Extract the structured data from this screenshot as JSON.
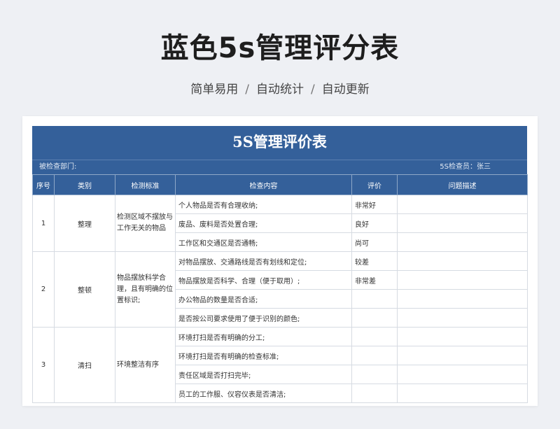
{
  "page": {
    "title": "蓝色5s管理评分表",
    "features": [
      "简单易用",
      "自动统计",
      "自动更新"
    ],
    "separator": "/"
  },
  "sheet": {
    "title": "5S管理评价表",
    "dept_label": "被检查部门:",
    "inspector_label": "5S检查员：张三",
    "columns": [
      "序号",
      "类别",
      "检测标准",
      "检查内容",
      "评价",
      "问题描述"
    ],
    "groups": [
      {
        "no": "1",
        "category": "整理",
        "standard": "检测区域不摆放与工作无关的物品",
        "items": [
          {
            "content": "个人物品是否有合理收纳;",
            "rating": "非常好",
            "issue": ""
          },
          {
            "content": "废品、废料是否处置合理;",
            "rating": "良好",
            "issue": ""
          },
          {
            "content": "工作区和交通区是否通畅;",
            "rating": "尚可",
            "issue": ""
          }
        ]
      },
      {
        "no": "2",
        "category": "整顿",
        "standard": "物品摆放科学合理，且有明确的位置标识;",
        "items": [
          {
            "content": "对物品摆放、交通路线是否有划线和定位;",
            "rating": "较差",
            "issue": ""
          },
          {
            "content": "物品摆放是否科学、合理（便于取用）;",
            "rating": "非常差",
            "issue": ""
          },
          {
            "content": "办公物品的数量是否合适;",
            "rating": "",
            "issue": ""
          },
          {
            "content": "是否按公司要求使用了便于识别的颜色;",
            "rating": "",
            "issue": ""
          }
        ]
      },
      {
        "no": "3",
        "category": "清扫",
        "standard": "环境整洁有序",
        "items": [
          {
            "content": "环境打扫是否有明确的分工;",
            "rating": "",
            "issue": ""
          },
          {
            "content": "环境打扫是否有明确的检查标准;",
            "rating": "",
            "issue": ""
          },
          {
            "content": "责任区域是否打扫完毕;",
            "rating": "",
            "issue": ""
          },
          {
            "content": "员工的工作服、仪容仪表是否清洁;",
            "rating": "",
            "issue": ""
          }
        ]
      }
    ]
  },
  "colors": {
    "header_blue": "#34609a",
    "page_bg": "#eef0f4"
  }
}
